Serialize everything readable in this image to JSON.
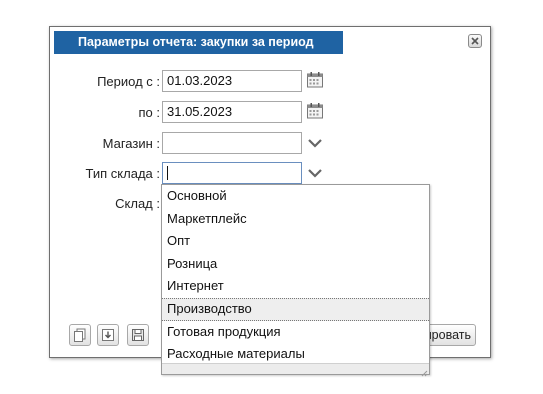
{
  "dialog": {
    "title": "Параметры отчета: закупки за период",
    "fields": {
      "period_from_label": "Период с :",
      "period_from_value": "01.03.2023",
      "period_to_label": "по :",
      "period_to_value": "31.05.2023",
      "store_label": "Магазин :",
      "store_value": "",
      "warehouse_type_label": "Тип склада :",
      "warehouse_type_value": "",
      "warehouse_label": "Склад :"
    },
    "action_button_label": "ировать",
    "icons": {
      "close": "close-icon",
      "calendar": "calendar-icon",
      "dropdown": "chevron-down-icon",
      "copy": "copy-icon",
      "download": "download-icon",
      "save": "save-icon"
    }
  },
  "dropdown": {
    "options": [
      "Основной",
      "Маркетплейс",
      "Опт",
      "Розница",
      "Интернет",
      "Производство",
      "Готовая продукция",
      "Расходные материалы"
    ],
    "hovered_index": 5
  },
  "colors": {
    "title_bar": "#1f63a3",
    "title_text": "#ffffff"
  }
}
